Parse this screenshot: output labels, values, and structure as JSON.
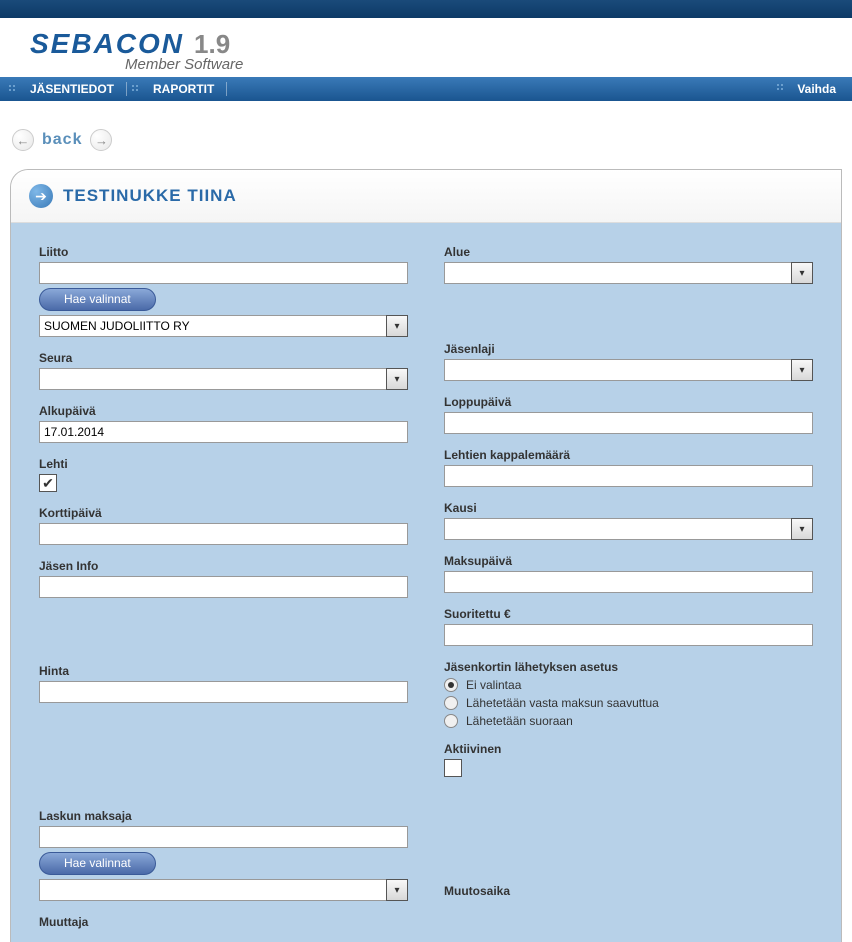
{
  "logo": {
    "name": "SEBACON",
    "version": "1.9",
    "subtitle": "Member Software"
  },
  "menu": {
    "items": [
      "JÄSENTIEDOT",
      "RAPORTIT"
    ],
    "right": "Vaihda"
  },
  "back": {
    "label": "back"
  },
  "pageTitle": "TESTINUKKE TIINA",
  "form": {
    "left": {
      "liitto": {
        "label": "Liitto",
        "value": "",
        "hae": "Hae valinnat",
        "selected": "SUOMEN JUDOLIITTO RY"
      },
      "seura": {
        "label": "Seura",
        "value": ""
      },
      "alkupaiva": {
        "label": "Alkupäivä",
        "value": "17.01.2014"
      },
      "lehti": {
        "label": "Lehti",
        "checked": true
      },
      "korttipaiva": {
        "label": "Korttipäivä",
        "value": ""
      },
      "jaseninfo": {
        "label": "Jäsen Info",
        "value": ""
      },
      "hinta": {
        "label": "Hinta",
        "value": ""
      },
      "laskunmaksaja": {
        "label": "Laskun maksaja",
        "value": "",
        "hae": "Hae valinnat"
      },
      "muuttaja": {
        "label": "Muuttaja"
      }
    },
    "right": {
      "alue": {
        "label": "Alue",
        "value": ""
      },
      "jasenlaji": {
        "label": "Jäsenlaji",
        "value": ""
      },
      "loppupaiva": {
        "label": "Loppupäivä",
        "value": ""
      },
      "lehtienkpl": {
        "label": "Lehtien kappalemäärä",
        "value": ""
      },
      "kausi": {
        "label": "Kausi",
        "value": ""
      },
      "maksupaiva": {
        "label": "Maksupäivä",
        "value": ""
      },
      "suoritettu": {
        "label": "Suoritettu €",
        "value": ""
      },
      "jasenkortti": {
        "label": "Jäsenkortin lähetyksen asetus",
        "options": [
          "Ei valintaa",
          "Lähetetään vasta maksun saavuttua",
          "Lähetetään suoraan"
        ],
        "selected": 0
      },
      "aktiivinen": {
        "label": "Aktiivinen",
        "checked": false
      },
      "muutosaika": {
        "label": "Muutosaika"
      }
    }
  }
}
